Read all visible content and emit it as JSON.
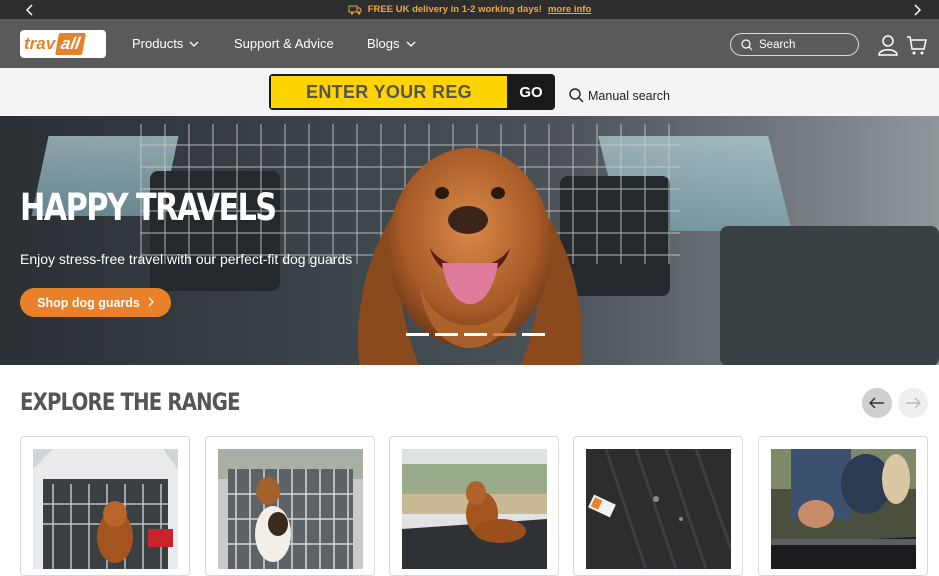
{
  "announcement": {
    "text": "FREE UK delivery in 1-2 working days!",
    "link": "more info"
  },
  "header": {
    "logo": {
      "part1": "trav",
      "part2": "all"
    },
    "nav": [
      {
        "label": "Products",
        "has_dropdown": true
      },
      {
        "label": "Support & Advice",
        "has_dropdown": false
      },
      {
        "label": "Blogs",
        "has_dropdown": true
      }
    ],
    "search_placeholder": "Search"
  },
  "reg_search": {
    "input_placeholder": "ENTER YOUR REG",
    "go_label": "GO",
    "manual_label": "Manual search"
  },
  "hero": {
    "title": "HAPPY TRAVELS",
    "subtitle": "Enjoy stress-free travel with our perfect-fit dog guards",
    "cta": "Shop dog guards",
    "slide_count": 5,
    "active_slide": 4
  },
  "explore": {
    "title": "EXPLORE THE RANGE",
    "cards": [
      {
        "image": "dog-in-car-boot-guard"
      },
      {
        "image": "beagle-in-dog-cage"
      },
      {
        "image": "spaniel-on-boot-liner"
      },
      {
        "image": "rubber-car-mat"
      },
      {
        "image": "boot-sill-protector"
      }
    ]
  },
  "colors": {
    "accent": "#e8812a",
    "header": "#5a5a5a",
    "announcement_bg": "#2e2e2e",
    "reg_yellow": "#ffd400"
  }
}
